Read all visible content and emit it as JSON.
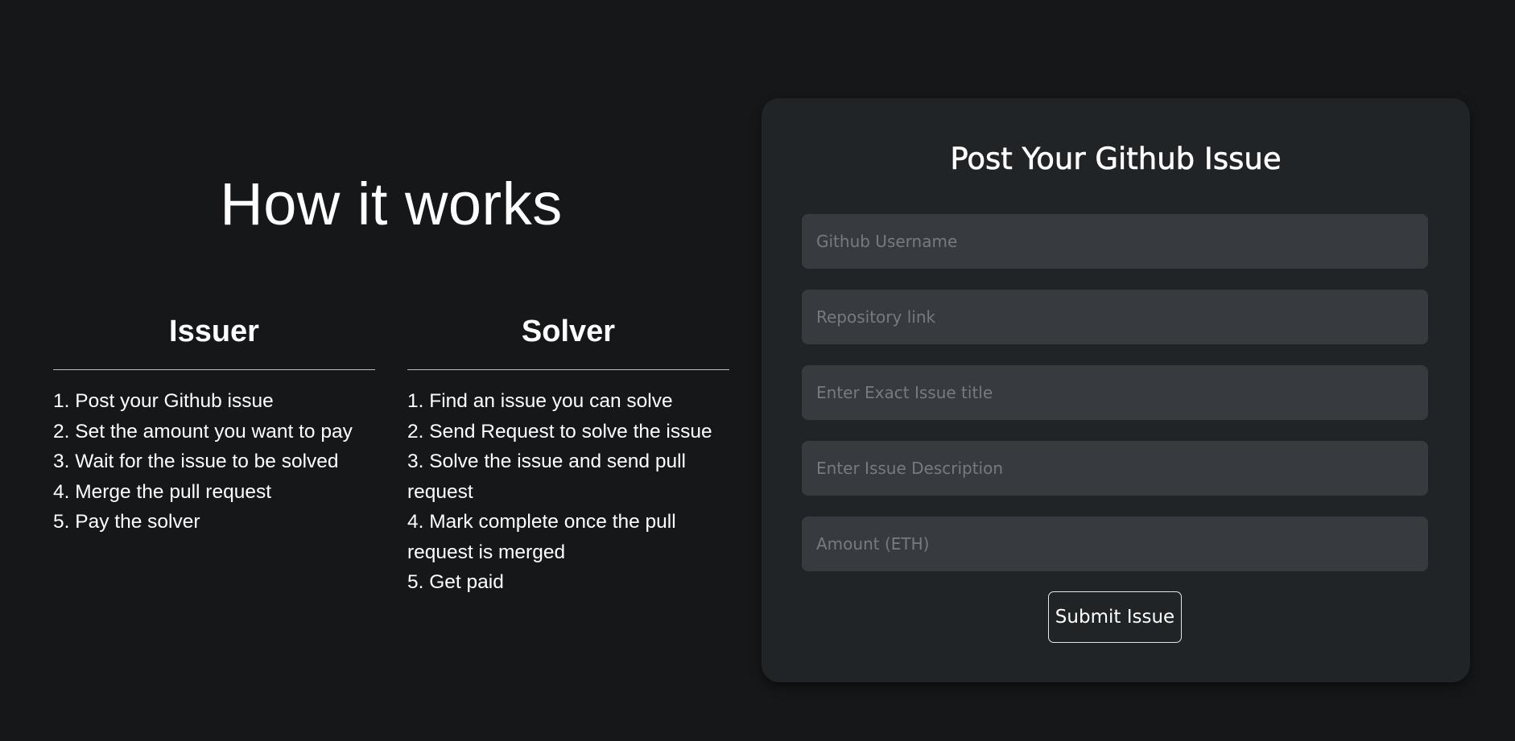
{
  "how_it_works": {
    "title": "How it works",
    "issuer": {
      "heading": "Issuer",
      "steps": [
        "1. Post your Github issue",
        "2. Set the amount you want to pay",
        "3. Wait for the issue to be solved",
        "4. Merge the pull request",
        "5. Pay the solver"
      ]
    },
    "solver": {
      "heading": "Solver",
      "steps": [
        "1. Find an issue you can solve",
        "2. Send Request to solve the issue",
        "3. Solve the issue and send pull request",
        "4. Mark complete once the pull request is merged",
        "5. Get paid"
      ]
    }
  },
  "form": {
    "title": "Post Your Github Issue",
    "fields": {
      "username": {
        "value": "",
        "placeholder": "Github Username"
      },
      "repository": {
        "value": "",
        "placeholder": "Repository link"
      },
      "issue_title": {
        "value": "",
        "placeholder": "Enter Exact Issue title"
      },
      "description": {
        "value": "",
        "placeholder": "Enter Issue Description"
      },
      "amount": {
        "value": "",
        "placeholder": "Amount (ETH)"
      }
    },
    "submit_label": "Submit Issue"
  },
  "colors": {
    "background": "#151719",
    "card": "#212427",
    "input": "#373a3e",
    "placeholder": "#767b81",
    "text": "#ffffff"
  }
}
